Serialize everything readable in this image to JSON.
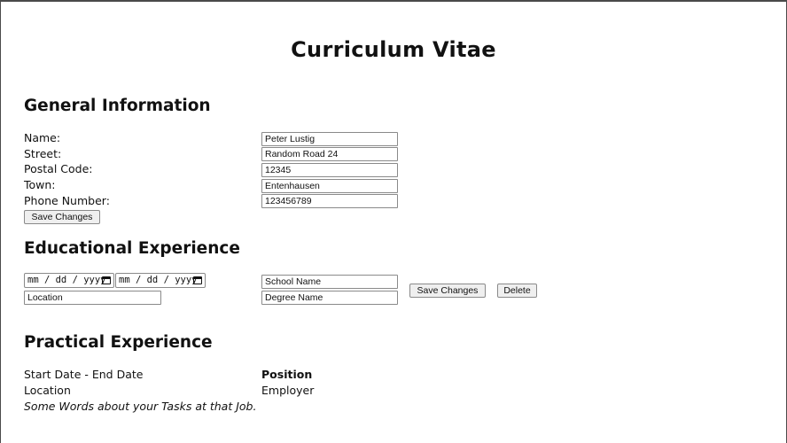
{
  "page": {
    "title": "Curriculum Vitae"
  },
  "general": {
    "heading": "General Information",
    "labels": {
      "name": "Name:",
      "street": "Street:",
      "postal": "Postal Code:",
      "town": "Town:",
      "phone": "Phone Number:"
    },
    "values": {
      "name": "Peter Lustig",
      "street": "Random Road 24",
      "postal": "12345",
      "town": "Entenhausen",
      "phone": "123456789"
    },
    "save_label": "Save Changes"
  },
  "education": {
    "heading": "Educational Experience",
    "date_placeholder": "mm / dd / yyyy",
    "location_placeholder": "Location",
    "school_placeholder": "School Name",
    "degree_placeholder": "Degree Name",
    "save_label": "Save Changes",
    "delete_label": "Delete"
  },
  "practical": {
    "heading": "Practical Experience",
    "dates": "Start Date - End Date",
    "position": "Position",
    "location": "Location",
    "employer": "Employer",
    "tasks": "Some Words about your Tasks at that Job."
  }
}
